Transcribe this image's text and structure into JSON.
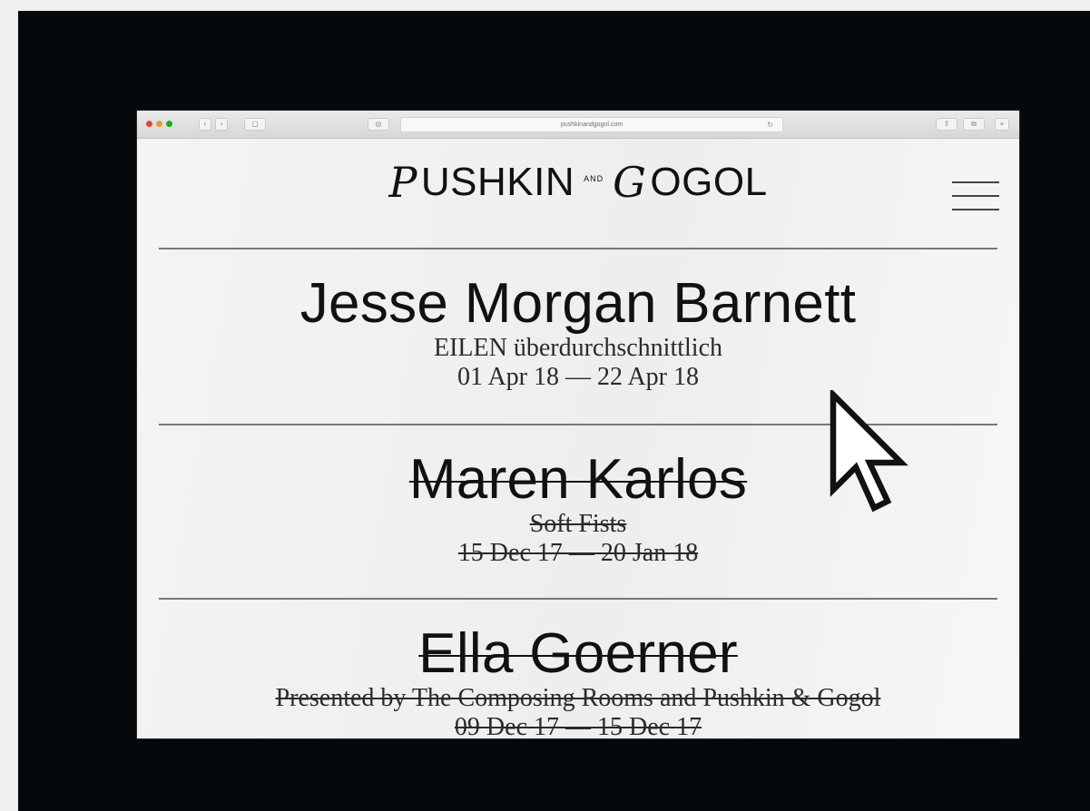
{
  "browser": {
    "url": "pushkinandgogol.com",
    "nav_back": "‹",
    "nav_forward": "›",
    "sidebar_icon": "▢",
    "shield_icon": "◎",
    "reload_icon": "↻",
    "share_icon": "⇪",
    "tabs_icon": "⧉"
  },
  "site": {
    "logo_left": "USHKIN",
    "logo_and": "AND",
    "logo_right": "OGOL",
    "logo_p_ornament": "P",
    "logo_g_ornament": "G"
  },
  "exhibitions": [
    {
      "artist": "Jesse Morgan Barnett",
      "title": "EILEN überdurchschnittlich",
      "dates": "01 Apr 18 — 22 Apr 18",
      "status": "current"
    },
    {
      "artist": "Maren Karlos",
      "title": "Soft Fists",
      "dates": "15 Dec 17 — 20 Jan 18",
      "status": "past"
    },
    {
      "artist": "Ella Goerner",
      "title": "Presented by The Composing Rooms and Pushkin & Gogol",
      "dates": "09 Dec 17 — 15 Dec 17",
      "status": "past"
    }
  ],
  "colors": {
    "frame": "#05090c",
    "light_close": "#e0443e",
    "light_min": "#dea236",
    "light_max": "#1aab29"
  }
}
